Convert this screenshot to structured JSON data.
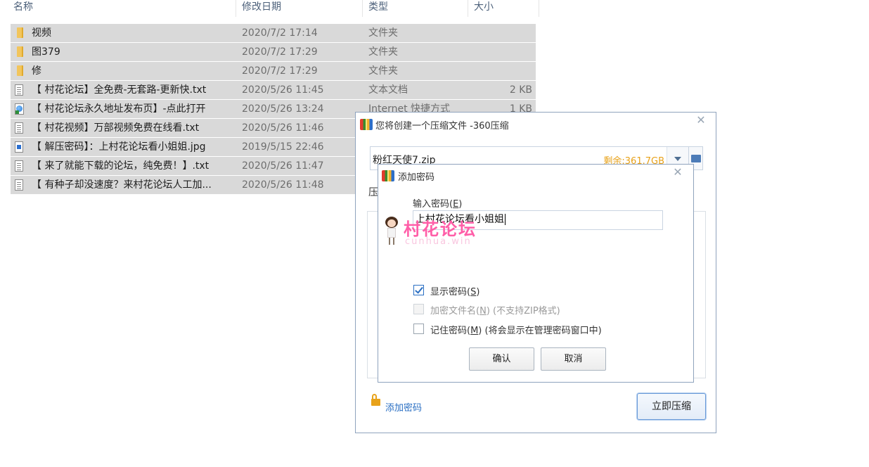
{
  "columns": {
    "name": "名称",
    "date": "修改日期",
    "type": "类型",
    "size": "大小"
  },
  "files": [
    {
      "icon": "folder-icon",
      "name": "视频",
      "date": "2020/7/2 17:14",
      "type": "文件夹",
      "size": ""
    },
    {
      "icon": "folder-icon",
      "name": "图379",
      "date": "2020/7/2 17:29",
      "type": "文件夹",
      "size": ""
    },
    {
      "icon": "folder-icon",
      "name": "修",
      "date": "2020/7/2 17:29",
      "type": "文件夹",
      "size": ""
    },
    {
      "icon": "text-file-icon",
      "name": "【 村花论坛】全免费-无套路-更新快.txt",
      "date": "2020/5/26 11:45",
      "type": "文本文档",
      "size": "2 KB"
    },
    {
      "icon": "shortcut-icon",
      "name": "【 村花论坛永久地址发布页】-点此打开",
      "date": "2020/5/26 13:24",
      "type": "Internet 快捷方式",
      "size": "1 KB"
    },
    {
      "icon": "text-file-icon",
      "name": "【 村花视频】万部视频免费在线看.txt",
      "date": "2020/5/26 11:46",
      "type": "",
      "size": ""
    },
    {
      "icon": "image-file-icon",
      "name": "【 解压密码】：上村花论坛看小姐姐.jpg",
      "date": "2019/5/15 22:46",
      "type": "",
      "size": ""
    },
    {
      "icon": "text-file-icon",
      "name": "【 来了就能下载的论坛，纯免费！】.txt",
      "date": "2020/5/26 11:47",
      "type": "",
      "size": ""
    },
    {
      "icon": "text-file-icon",
      "name": "【 有种子却没速度？来村花论坛人工加...",
      "date": "2020/5/26 11:48",
      "type": "",
      "size": ""
    }
  ],
  "compress_dialog": {
    "title": "您将创建一个压缩文件 -360压缩",
    "filename": "粉红天使7.zip",
    "free_space": "剩余:361.7GB",
    "partial_label": "压",
    "add_password_link": "添加密码",
    "compress_button": "立即压缩",
    "close_symbol": "✕"
  },
  "password_dialog": {
    "title": "添加密码",
    "input_label_prefix": "输入密码(",
    "input_label_key": "E",
    "input_label_suffix": ")",
    "password_value": "上村花论坛看小姐姐",
    "show_password": {
      "prefix": "显示密码(",
      "key": "S",
      "suffix": ")",
      "checked": true
    },
    "encrypt_filenames": {
      "prefix": "加密文件名(",
      "key": "N",
      "suffix": ") (不支持ZIP格式)",
      "checked": false,
      "disabled": true
    },
    "remember_password": {
      "prefix": "记住密码(",
      "key": "M",
      "suffix": ") (将会显示在管理密码窗口中)",
      "checked": false
    },
    "ok_button": "确认",
    "cancel_button": "取消",
    "close_symbol": "✕"
  },
  "watermark": {
    "text": "村花论坛",
    "sub": "cunhua.win"
  },
  "colors": {
    "row_selected": "#d9d9d9",
    "accent": "#2a6fc3",
    "free_space": "#e8a21a",
    "watermark": "#ff5ea8"
  }
}
